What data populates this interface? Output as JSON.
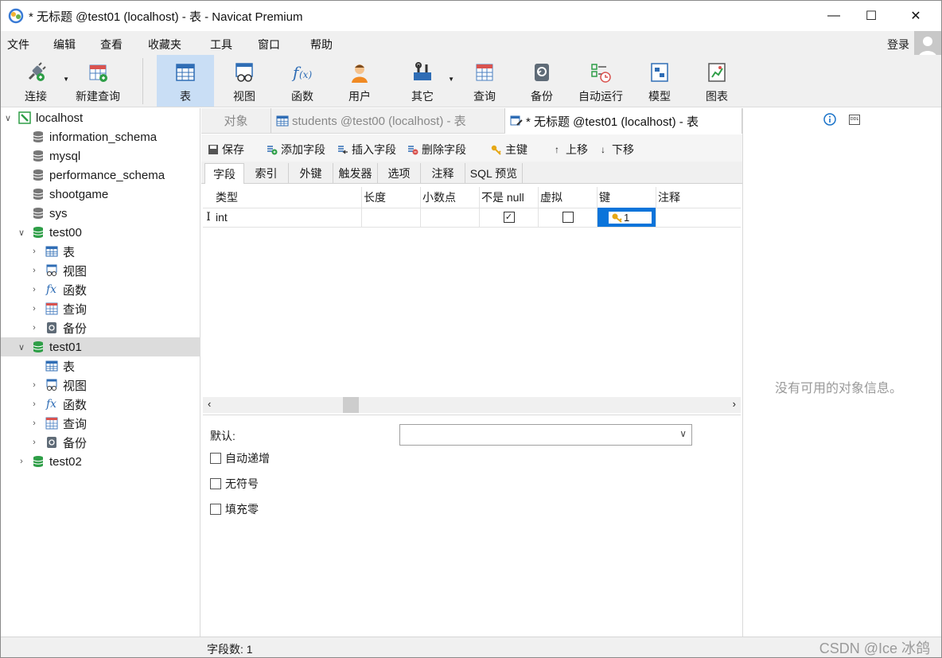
{
  "window": {
    "title": "* 无标题 @test01 (localhost) - 表 - Navicat Premium",
    "minimize": "—",
    "maximize": "☐",
    "close": "✕"
  },
  "menu": {
    "items": [
      "文件",
      "编辑",
      "查看",
      "收藏夹",
      "工具",
      "窗口",
      "帮助"
    ],
    "login": "登录"
  },
  "toolbar": {
    "items": [
      "连接",
      "新建查询",
      "表",
      "视图",
      "函数",
      "用户",
      "其它",
      "查询",
      "备份",
      "自动运行",
      "模型",
      "图表"
    ],
    "active": "表"
  },
  "navigator": {
    "connection": "localhost",
    "databases": [
      "information_schema",
      "mysql",
      "performance_schema",
      "shootgame",
      "sys"
    ],
    "test00": {
      "name": "test00",
      "children": [
        "表",
        "视图",
        "函数",
        "查询",
        "备份"
      ]
    },
    "test01": {
      "name": "test01",
      "children": [
        "表",
        "视图",
        "函数",
        "查询",
        "备份"
      ]
    },
    "test02": "test02"
  },
  "tabs": {
    "objects": "对象",
    "students": "students @test00 (localhost) - 表",
    "current": "* 无标题 @test01 (localhost) - 表"
  },
  "editor_toolbar": {
    "save": "保存",
    "add_field": "添加字段",
    "insert_field": "插入字段",
    "delete_field": "删除字段",
    "primary_key": "主键",
    "move_up": "上移",
    "move_down": "下移"
  },
  "subtabs": [
    "字段",
    "索引",
    "外键",
    "触发器",
    "选项",
    "注释",
    "SQL 预览"
  ],
  "grid": {
    "columns": [
      "类型",
      "长度",
      "小数点",
      "不是 null",
      "虚拟",
      "键",
      "注释"
    ],
    "rows": [
      {
        "marker": "I",
        "type": "int",
        "length": "",
        "decimals": "",
        "not_null": true,
        "virtual": false,
        "key": "1",
        "comment": ""
      }
    ]
  },
  "props": {
    "default_label": "默认:",
    "default_value": "",
    "auto_increment": "自动递增",
    "unsigned": "无符号",
    "zerofill": "填充零"
  },
  "info_panel": {
    "message": "没有可用的对象信息。",
    "ddl_label": "DDL"
  },
  "status": {
    "field_count": "字段数: 1",
    "watermark": "CSDN @Ice 冰鸽"
  }
}
